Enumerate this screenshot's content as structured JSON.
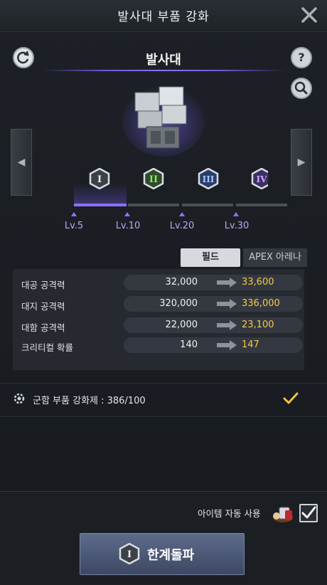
{
  "window": {
    "title": "발사대 부품 강화"
  },
  "part": {
    "name": "발사대"
  },
  "tiers": [
    {
      "numeral": "I",
      "level": "Lv.5"
    },
    {
      "numeral": "II",
      "level": "Lv.10"
    },
    {
      "numeral": "III",
      "level": "Lv.20"
    },
    {
      "numeral": "IV",
      "level": "Lv.30"
    }
  ],
  "tabs": {
    "field": "필드",
    "apex": "APEX 아레나"
  },
  "stats": [
    {
      "label": "대공 공격력",
      "current": "32,000",
      "next": "33,600"
    },
    {
      "label": "대지 공격력",
      "current": "320,000",
      "next": "336,000"
    },
    {
      "label": "대함 공격력",
      "current": "22,000",
      "next": "23,100"
    },
    {
      "label": "크리티컬 확률",
      "current": "140",
      "next": "147"
    }
  ],
  "material": {
    "label": "군함 부품 강화제 : 386/100"
  },
  "auto_use": {
    "label": "아이템 자동 사용",
    "checked": true
  },
  "limit_break": {
    "label": "한계돌파",
    "numeral": "I"
  },
  "colors": {
    "accent": "#8a72ff",
    "upgrade_value": "#f5c84b",
    "check": "#f2c531"
  }
}
